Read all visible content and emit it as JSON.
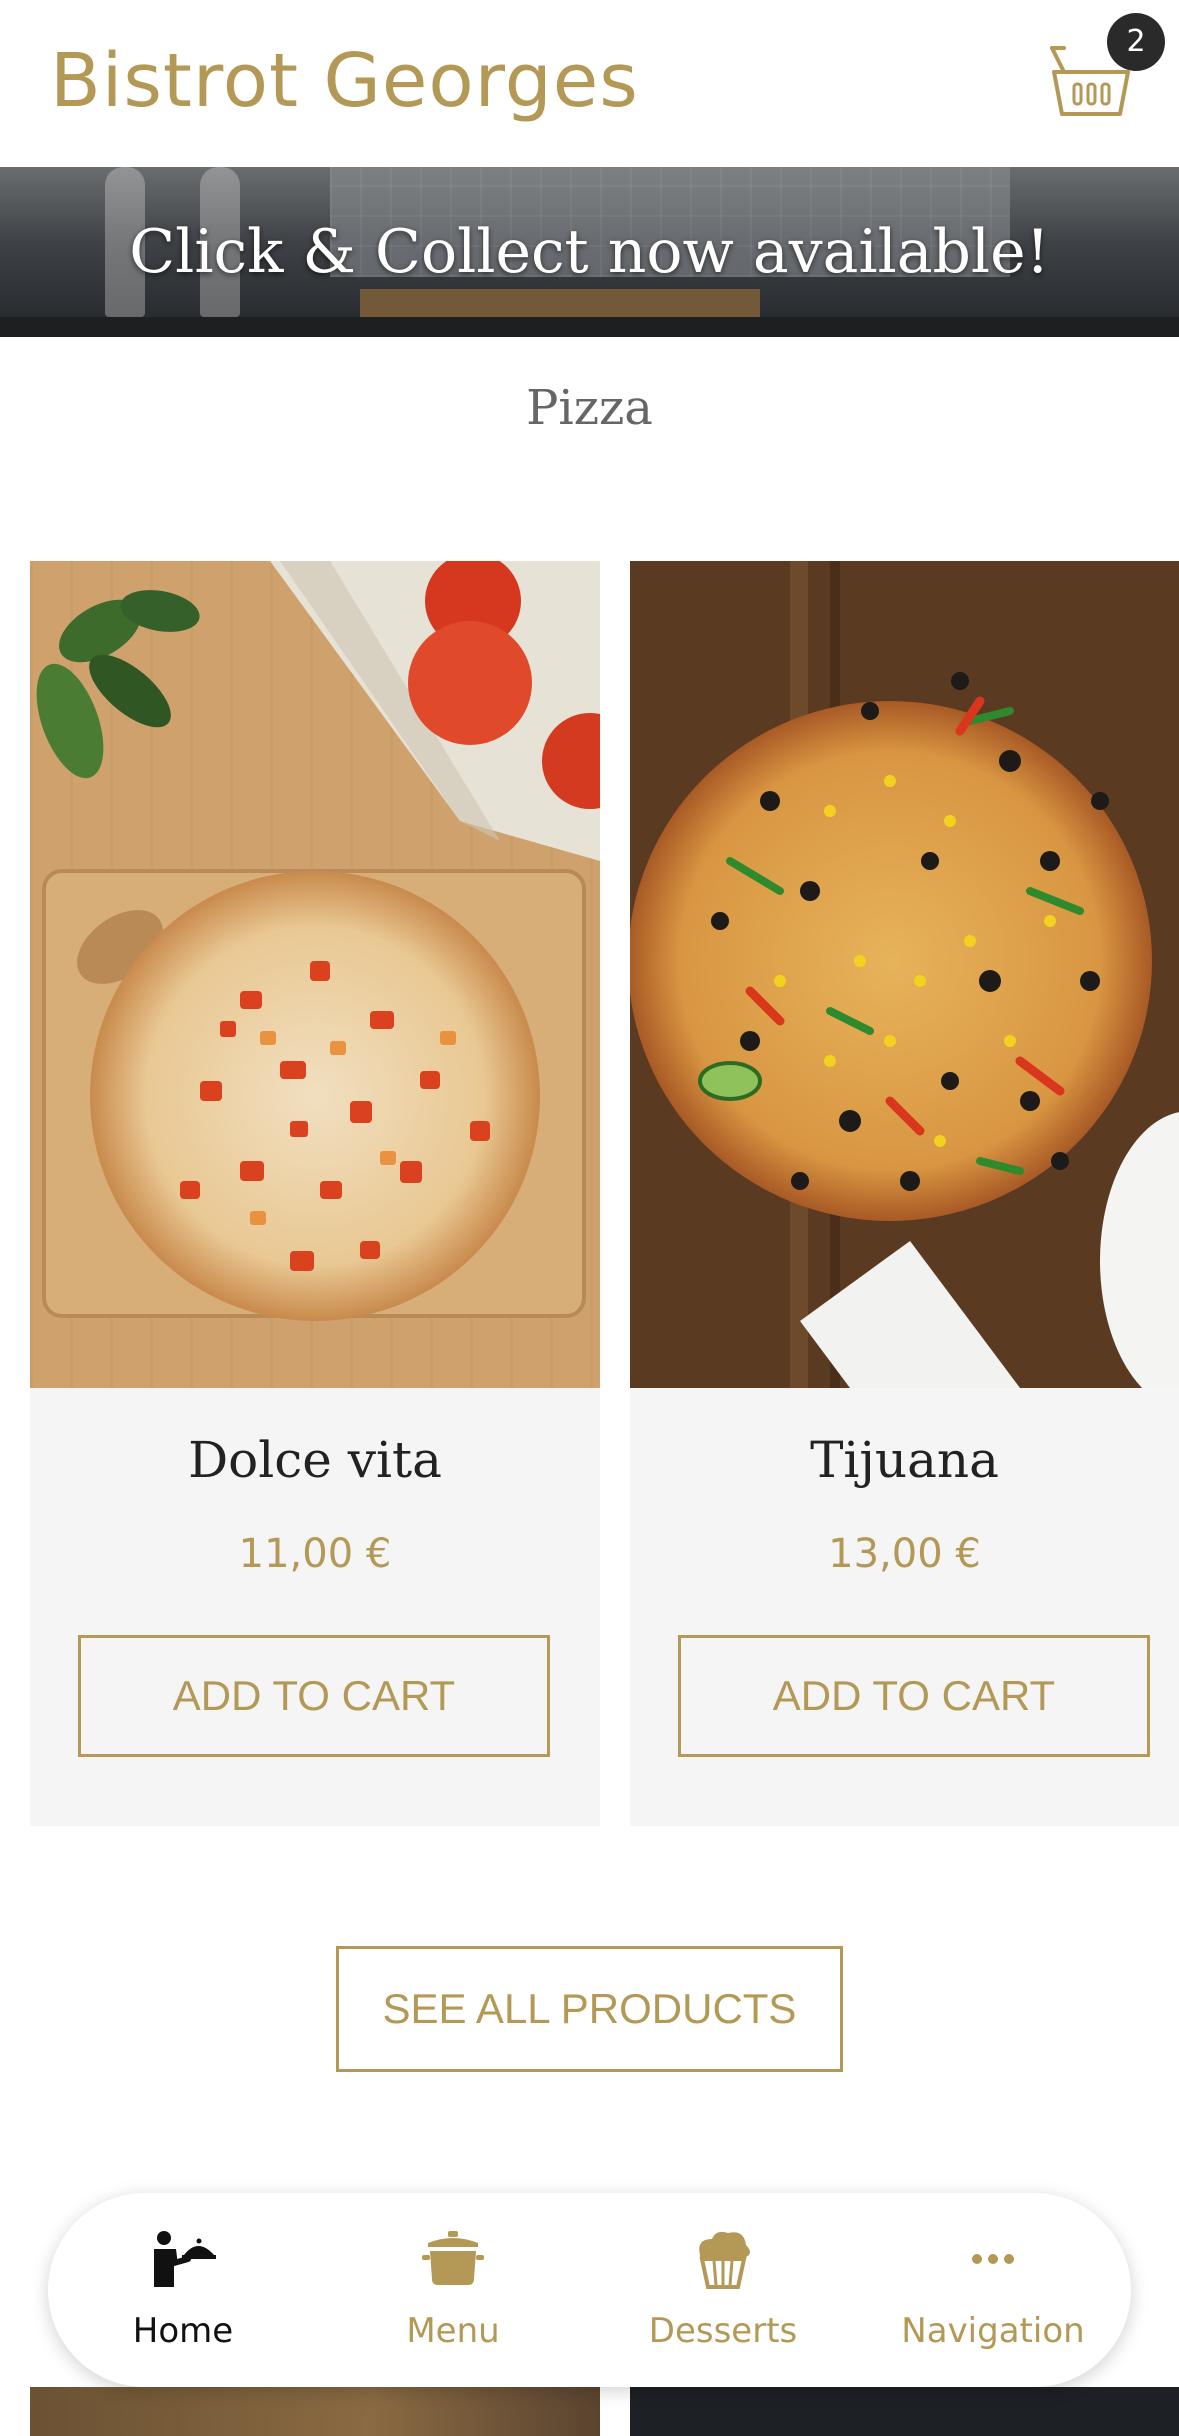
{
  "header": {
    "brand": "Bistrot Georges",
    "cart_icon": "basket-icon",
    "cart_count": "2"
  },
  "banner": {
    "text": "Click & Collect now available!"
  },
  "section": {
    "title": "Pizza"
  },
  "products": [
    {
      "name": "Dolce vita",
      "price": "11,00 €",
      "button": "ADD TO CART"
    },
    {
      "name": "Tijuana",
      "price": "13,00 €",
      "button": "ADD TO CART"
    }
  ],
  "see_all": "SEE ALL PRODUCTS",
  "bottom_nav": {
    "items": [
      {
        "label": "Home",
        "icon": "waiter-icon",
        "active": true
      },
      {
        "label": "Menu",
        "icon": "pot-icon",
        "active": false
      },
      {
        "label": "Desserts",
        "icon": "cupcake-icon",
        "active": false
      },
      {
        "label": "Navigation",
        "icon": "more-dots-icon",
        "active": false
      }
    ]
  },
  "colors": {
    "accent": "#b39955",
    "text_dark": "#222222",
    "card_bg": "#f5f5f5"
  }
}
